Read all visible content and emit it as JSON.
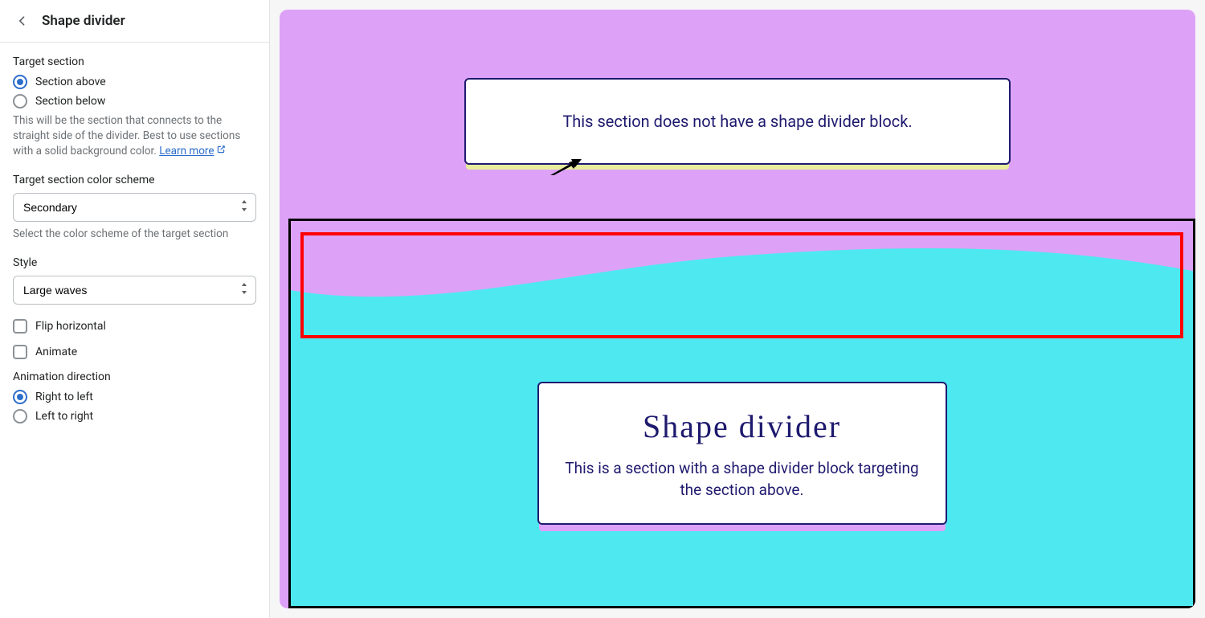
{
  "sidebar": {
    "title": "Shape divider",
    "target_section": {
      "label": "Target section",
      "options": [
        "Section above",
        "Section below"
      ],
      "selected": 0,
      "help": "This will be the section that connects to the straight side of the divider. Best to use sections with a solid background color. ",
      "learn_more": "Learn more"
    },
    "color_scheme": {
      "label": "Target section color scheme",
      "value": "Secondary",
      "help": "Select the color scheme of the target section"
    },
    "style": {
      "label": "Style",
      "value": "Large waves"
    },
    "flip_horizontal": {
      "label": "Flip horizontal",
      "checked": false
    },
    "animate": {
      "label": "Animate",
      "checked": false
    },
    "animation_direction": {
      "label": "Animation direction",
      "options": [
        "Right to left",
        "Left to right"
      ],
      "selected": 0
    }
  },
  "preview": {
    "top_card": "This section does not have a shape divider block.",
    "bottom_card_title": "Shape divider",
    "bottom_card_text": "This is a section with a shape divider block targeting the section above.",
    "colors": {
      "section_above": "#dda2f7",
      "section_below": "#4ee8f1",
      "selection_outline": "#000000",
      "highlight_box": "#ff0000",
      "card_border": "#1e1a6e"
    }
  }
}
